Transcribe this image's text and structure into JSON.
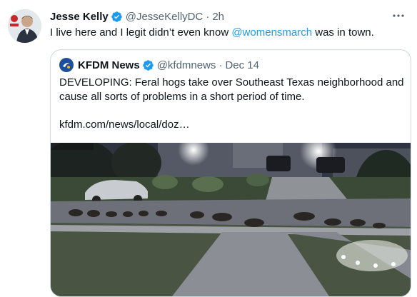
{
  "tweet": {
    "author_name": "Jesse Kelly",
    "author_handle": "@JesseKellyDC",
    "separator": "·",
    "time": "2h",
    "text_before": "I live here and I legit didn’t even know ",
    "mention": "@womensmarch",
    "text_after": " was in town."
  },
  "quoted": {
    "author_name": "KFDM News",
    "author_handle": "@kfdmnews",
    "separator": "·",
    "date": "Dec 14",
    "text": "DEVELOPING: Feral hogs take over Southeast Texas neighborhood and cause all sorts of problems in a short period of time.",
    "link": "kfdm.com/news/local/doz…"
  },
  "icons": {
    "verified": "verified-badge-icon",
    "more": "more-options-icon",
    "kfdm_logo": "kfdm-logo-icon"
  },
  "colors": {
    "accent": "#1d9bf0",
    "text": "#0f1419",
    "secondary": "#536471",
    "border": "#cfd9de"
  }
}
